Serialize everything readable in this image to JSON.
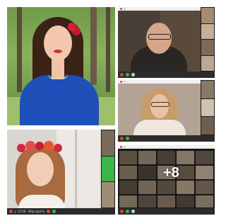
{
  "collage": {
    "more_count": "+8"
  },
  "tiles": {
    "singer": {
      "caption": "",
      "flowers": "flower-wreath-icon"
    },
    "professor": {
      "caption": ""
    },
    "girl_glasses": {
      "caption": ""
    },
    "girl_wreath": {
      "caption": "J. 12:00 · Маргарита"
    },
    "gallery": {
      "caption": ""
    }
  },
  "colors": {
    "bar_bg": "#2b2b2b",
    "mute_red": "#e0413a",
    "video_green": "#3bb54a"
  }
}
